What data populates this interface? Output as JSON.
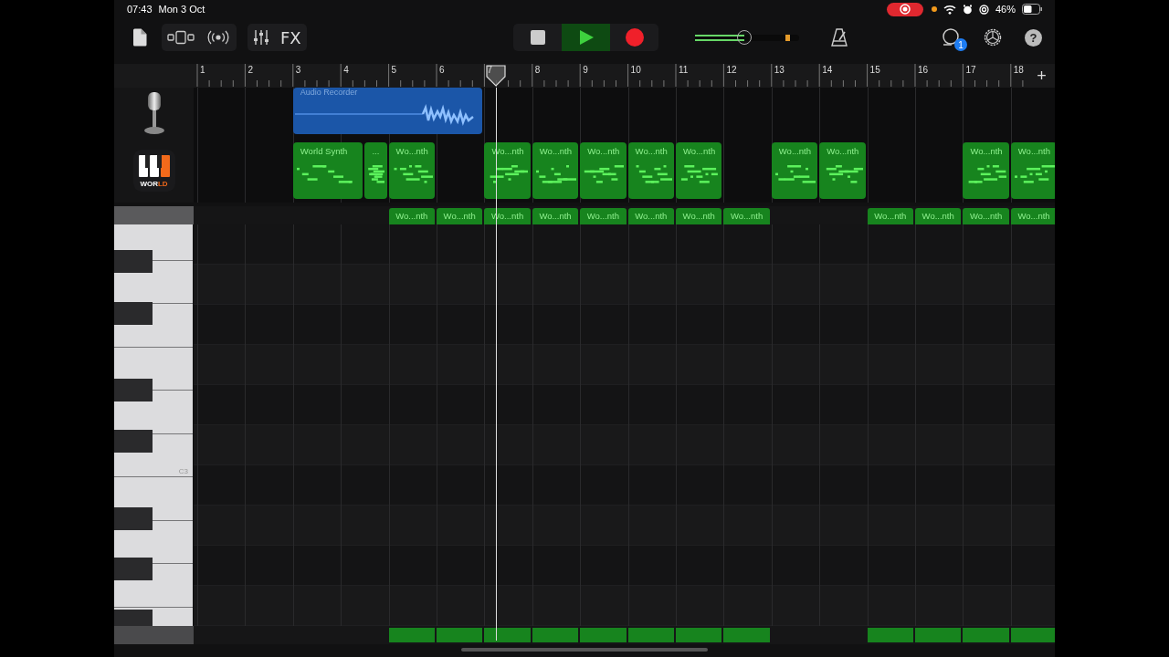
{
  "status_bar": {
    "time": "07:43",
    "date": "Mon 3 Oct",
    "recording_pill": true,
    "battery_text": "46%"
  },
  "toolbar": {
    "fx_label": "FX",
    "transport": [
      {
        "kind": "stop",
        "selected": false
      },
      {
        "kind": "play",
        "selected": true
      },
      {
        "kind": "record",
        "selected": false
      }
    ],
    "volume": {
      "level": 0.47
    },
    "loop_badge": "1",
    "help_label": "?"
  },
  "ruler": {
    "bars": [
      "1",
      "2",
      "3",
      "4",
      "5",
      "6",
      "7",
      "8",
      "9",
      "10",
      "11",
      "12",
      "13",
      "14",
      "15",
      "16",
      "17",
      "18"
    ],
    "add_label": "+"
  },
  "playhead": {
    "level": 0.3616
  },
  "tracks": [
    {
      "kind": "audio",
      "bars": [
        {
          "kind": "empty"
        },
        {
          "kind": "empty"
        },
        {
          "kind": "start",
          "title": "Audio Recorder"
        },
        {
          "kind": "continued"
        },
        {
          "kind": "continued"
        },
        {
          "kind": "continued"
        },
        {
          "kind": "empty"
        },
        {
          "kind": "empty"
        },
        {
          "kind": "empty"
        },
        {
          "kind": "empty"
        },
        {
          "kind": "empty"
        },
        {
          "kind": "empty"
        },
        {
          "kind": "empty"
        },
        {
          "kind": "empty"
        },
        {
          "kind": "empty"
        },
        {
          "kind": "empty"
        },
        {
          "kind": "empty"
        },
        {
          "kind": "empty"
        }
      ]
    },
    {
      "kind": "instrument",
      "icon_text": [
        {
          "text": "WOR",
          "accent": false
        },
        {
          "text": "LD",
          "accent": true
        }
      ],
      "bars": [
        {
          "kind": "empty"
        },
        {
          "kind": "empty"
        },
        {
          "kind": "start",
          "title": "World Synth"
        },
        {
          "kind": "half_then_start",
          "title": "..."
        },
        {
          "kind": "start",
          "title": "Wo...nth"
        },
        {
          "kind": "empty"
        },
        {
          "kind": "start",
          "title": "Wo...nth"
        },
        {
          "kind": "start",
          "title": "Wo...nth"
        },
        {
          "kind": "start",
          "title": "Wo...nth"
        },
        {
          "kind": "start",
          "title": "Wo...nth"
        },
        {
          "kind": "start",
          "title": "Wo...nth"
        },
        {
          "kind": "empty"
        },
        {
          "kind": "start",
          "title": "Wo...nth"
        },
        {
          "kind": "start",
          "title": "Wo...nth"
        },
        {
          "kind": "empty"
        },
        {
          "kind": "empty"
        },
        {
          "kind": "start",
          "title": "Wo...nth"
        },
        {
          "kind": "start",
          "title": "Wo...nth"
        }
      ]
    }
  ],
  "piano_roll": {
    "key_label": "C3",
    "bars": [
      {
        "kind": "empty"
      },
      {
        "kind": "empty"
      },
      {
        "kind": "empty"
      },
      {
        "kind": "empty"
      },
      {
        "kind": "start",
        "title": "Wo...nth"
      },
      {
        "kind": "start",
        "title": "Wo...nth"
      },
      {
        "kind": "start",
        "title": "Wo...nth"
      },
      {
        "kind": "start",
        "title": "Wo...nth"
      },
      {
        "kind": "start",
        "title": "Wo...nth"
      },
      {
        "kind": "start",
        "title": "Wo...nth"
      },
      {
        "kind": "start",
        "title": "Wo...nth"
      },
      {
        "kind": "start",
        "title": "Wo...nth"
      },
      {
        "kind": "empty"
      },
      {
        "kind": "empty"
      },
      {
        "kind": "start",
        "title": "Wo...nth"
      },
      {
        "kind": "start",
        "title": "Wo...nth"
      },
      {
        "kind": "start",
        "title": "Wo...nth"
      },
      {
        "kind": "start",
        "title": "Wo...nth"
      }
    ]
  }
}
